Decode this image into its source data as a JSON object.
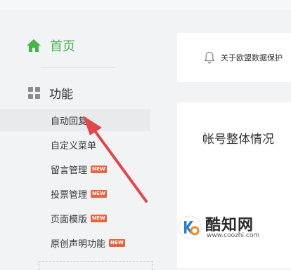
{
  "sidebar": {
    "home_label": "首页",
    "section_label": "功能",
    "items": [
      {
        "label": "自动回复",
        "badge": ""
      },
      {
        "label": "自定义菜单",
        "badge": ""
      },
      {
        "label": "留言管理",
        "badge": "NEW"
      },
      {
        "label": "投票管理",
        "badge": "NEW"
      },
      {
        "label": "页面模版",
        "badge": "NEW"
      },
      {
        "label": "原创声明功能",
        "badge": "NEW"
      }
    ]
  },
  "notice": {
    "text": "关于欧盟数据保护"
  },
  "main": {
    "title": "帐号整体情况"
  },
  "watermark": {
    "brand": "酷知网",
    "url": "www.coozhi.com"
  },
  "colors": {
    "accent_green": "#44b549",
    "badge_red": "#e5653f",
    "arrow_red": "#e0474c"
  }
}
